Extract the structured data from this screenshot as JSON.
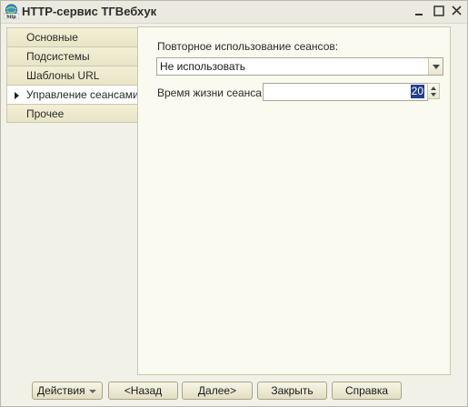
{
  "window": {
    "title": "HTTP-сервис ТГВебхук",
    "icon_name": "http-service-icon",
    "controls": {
      "minimize": "minimize-icon",
      "maximize": "maximize-icon",
      "close": "close-icon"
    }
  },
  "tabs": {
    "items": [
      {
        "label": "Основные",
        "active": false
      },
      {
        "label": "Подсистемы",
        "active": false
      },
      {
        "label": "Шаблоны URL",
        "active": false
      },
      {
        "label": "Управление сеансами",
        "active": true
      },
      {
        "label": "Прочее",
        "active": false
      }
    ]
  },
  "session": {
    "reuse_label": "Повторное использование сеансов:",
    "reuse_value": "Не использовать",
    "lifetime_label": "Время жизни сеанса:",
    "lifetime_value": "20"
  },
  "buttons": {
    "actions": "Действия",
    "back": "<Назад",
    "next": "Далее>",
    "close": "Закрыть",
    "help": "Справка"
  },
  "colors": {
    "tab_bg": "#ece8cb",
    "panel_bg": "#fbfaf0",
    "selection": "#1f3f8f"
  }
}
